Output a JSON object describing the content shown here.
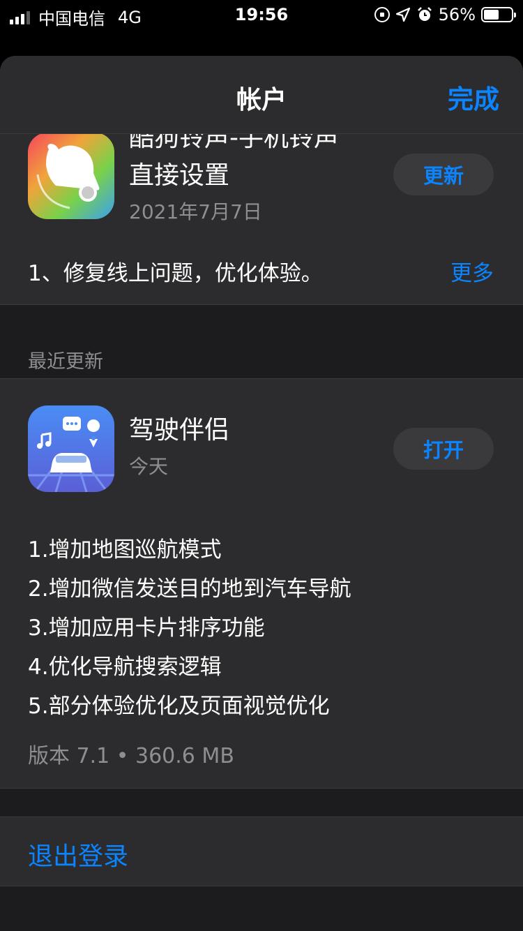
{
  "status_bar": {
    "carrier": "中国电信",
    "network": "4G",
    "time": "19:56",
    "battery": "56%",
    "battery_level": 0.56
  },
  "nav": {
    "title": "帐户",
    "done_label": "完成"
  },
  "pending_update": {
    "app_name_line1": "酷狗铃声-手机铃声",
    "app_name_line2": "直接设置",
    "date": "2021年7月7日",
    "button_label": "更新",
    "notes": "1、修复线上问题，优化体验。",
    "more_label": "更多"
  },
  "recent": {
    "section_title": "最近更新",
    "app_name": "驾驶伴侣",
    "date": "今天",
    "button_label": "打开",
    "notes": [
      "1.增加地图巡航模式",
      "2.增加微信发送目的地到汽车导航",
      "3.增加应用卡片排序功能",
      "4.优化导航搜索逻辑",
      "5.部分体验优化及页面视觉优化"
    ],
    "version_info": "版本 7.1 • 360.6 MB"
  },
  "sign_out_label": "退出登录",
  "colors": {
    "accent": "#0a84ff",
    "card": "#2c2c2e",
    "background": "#1c1c1e"
  }
}
